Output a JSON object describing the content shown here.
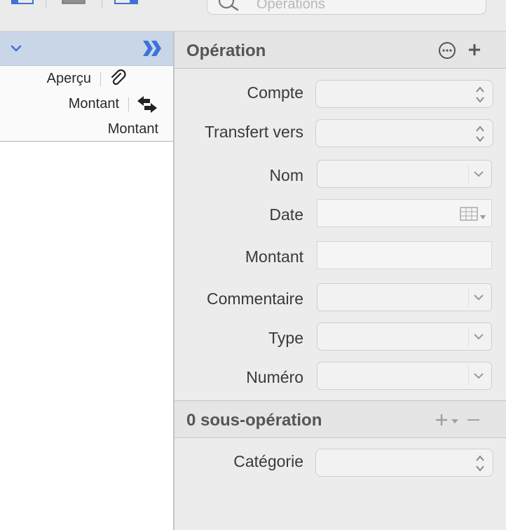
{
  "toolbar": {
    "search_placeholder": "Opérations",
    "icons": [
      "sidebar-toggle-icon",
      "view-icon",
      "detail-panel-icon",
      "search-icon"
    ]
  },
  "left_pane": {
    "header_icons": [
      "chevron-down-icon",
      "double-chevron-right-icon"
    ],
    "rows": [
      {
        "label": "Aperçu",
        "icon": "paperclip-icon"
      },
      {
        "label": "Montant",
        "icon": "swap-arrows-icon"
      },
      {
        "label": "Montant"
      }
    ]
  },
  "operation": {
    "title": "Opération",
    "actions": [
      "more-options-icon",
      "add-icon"
    ],
    "fields": {
      "compte": {
        "label": "Compte",
        "value": ""
      },
      "transfert": {
        "label": "Transfert vers",
        "value": ""
      },
      "nom": {
        "label": "Nom",
        "value": ""
      },
      "date": {
        "label": "Date",
        "value": ""
      },
      "montant": {
        "label": "Montant",
        "value": ""
      },
      "commentaire": {
        "label": "Commentaire",
        "value": ""
      },
      "type": {
        "label": "Type",
        "value": ""
      },
      "numero": {
        "label": "Numéro",
        "value": ""
      }
    }
  },
  "split": {
    "title": "0 sous-opération",
    "fields": {
      "categorie": {
        "label": "Catégorie",
        "value": ""
      }
    }
  },
  "colors": {
    "left_header": "#c9d6e8",
    "accent_blue": "#3d73d9",
    "pane_bg": "#ececec"
  }
}
